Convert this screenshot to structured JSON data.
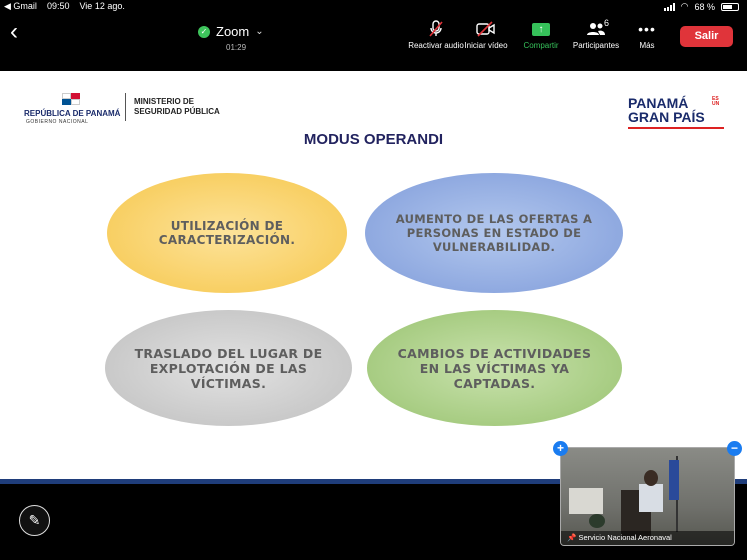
{
  "status_bar": {
    "back_app": "◀ Gmail",
    "time": "09:50",
    "date": "Vie 12 ago.",
    "battery": "68 %"
  },
  "toolbar": {
    "meeting_title": "Zoom",
    "timer": "01:29",
    "audio_label": "Reactivar audio",
    "video_label": "Iniciar vídeo",
    "share_label": "Compartir",
    "participants_label": "Participantes",
    "participants_count": "6",
    "more_label": "Más",
    "leave_label": "Salir",
    "colors": {
      "share": "#36c15a",
      "leave": "#e0343a"
    }
  },
  "slide": {
    "republic": "REPÚBLICA DE PANAMÁ",
    "government": "GOBIERNO NACIONAL",
    "ministry_line1": "MINISTERIO DE",
    "ministry_line2": "SEGURIDAD PÚBLICA",
    "brand_line1": "PANAMÁ",
    "brand_line2": "GRAN PAÍS",
    "brand_es_un": "ES UN",
    "title": "MODUS OPERANDI",
    "ovals": [
      {
        "text": "UTILIZACIÓN DE CARACTERIZACIÓN.",
        "color": "#f8cf63"
      },
      {
        "text": "AUMENTO DE LAS OFERTAS A PERSONAS EN ESTADO DE VULNERABILIDAD.",
        "color": "#8fa9e0"
      },
      {
        "text": "TRASLADO DEL LUGAR DE EXPLOTACIÓN DE LAS VÍCTIMAS.",
        "color": "#c9c9c9"
      },
      {
        "text": "CAMBIOS DE ACTIVIDADES EN LAS VÍCTIMAS YA CAPTADAS.",
        "color": "#a7cc82"
      }
    ]
  },
  "video_tile": {
    "name": "Servicio Nacional Aeronaval"
  }
}
